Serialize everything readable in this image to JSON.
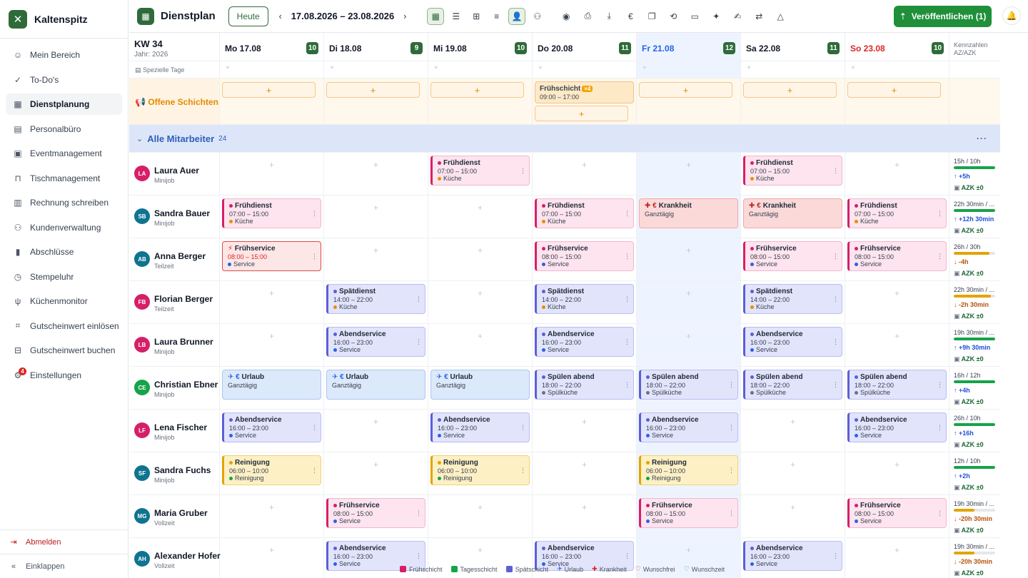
{
  "app": {
    "name": "Kaltenspitz"
  },
  "sidebar": {
    "items": [
      {
        "label": "Mein Bereich",
        "icon": "user-icon"
      },
      {
        "label": "To-Do's",
        "icon": "check-circle-icon"
      },
      {
        "label": "Dienstplanung",
        "icon": "calendar-icon",
        "active": true
      },
      {
        "label": "Personalbüro",
        "icon": "clipboard-icon"
      },
      {
        "label": "Eventmanagement",
        "icon": "calendar-event-icon"
      },
      {
        "label": "Tischmanagement",
        "icon": "table-icon"
      },
      {
        "label": "Rechnung schreiben",
        "icon": "invoice-icon"
      },
      {
        "label": "Kundenverwaltung",
        "icon": "users-icon"
      },
      {
        "label": "Abschlüsse",
        "icon": "chart-icon"
      },
      {
        "label": "Stempeluhr",
        "icon": "clock-icon"
      },
      {
        "label": "Küchenmonitor",
        "icon": "utensils-icon"
      },
      {
        "label": "Gutscheinwert einlösen",
        "icon": "scan-icon"
      },
      {
        "label": "Gutscheinwert buchen",
        "icon": "gift-icon"
      },
      {
        "label": "Einstellungen",
        "icon": "gear-icon",
        "badge": "4"
      }
    ],
    "logout": "Abmelden",
    "collapse": "Einklappen"
  },
  "toolbar": {
    "title": "Dienstplan",
    "today": "Heute",
    "daterange": "17.08.2026 – 23.08.2026",
    "publish": "Veröffentlichen (1)"
  },
  "header": {
    "week": "KW 34",
    "year": "Jahr: 2026",
    "special_days": "Spezielle Tage",
    "kennzahlen": "Kennzahlen",
    "kennzahlen_sub": "AZ/AZK",
    "days": [
      {
        "label": "Mo 17.08",
        "count": "10"
      },
      {
        "label": "Di 18.08",
        "count": "9"
      },
      {
        "label": "Mi 19.08",
        "count": "10"
      },
      {
        "label": "Do 20.08",
        "count": "11"
      },
      {
        "label": "Fr 21.08",
        "count": "12"
      },
      {
        "label": "Sa 22.08",
        "count": "11"
      },
      {
        "label": "So 23.08",
        "count": "10"
      }
    ]
  },
  "open_shifts": {
    "title": "Offene Schichten",
    "thursday": {
      "title": "Frühschicht",
      "badge": "×4",
      "time": "09:00 – 17:00"
    }
  },
  "group": {
    "title": "Alle Mitarbeiter",
    "count": "24"
  },
  "employees": [
    {
      "initials": "LA",
      "name": "Laura Auer",
      "type": "Minijob",
      "color": "#d61f69",
      "kz": {
        "a": "15h / 10h",
        "b": "↑ +5h",
        "c": "AZK ±0",
        "fill": 100,
        "fc": "#16a34a",
        "bc": "#1d4ed8"
      },
      "shifts": [
        null,
        null,
        {
          "k": "frueh",
          "t": "Frühdienst",
          "time": "07:00 – 15:00",
          "d": "Küche",
          "dc": "#ea8c00"
        },
        null,
        null,
        {
          "k": "frueh",
          "t": "Frühdienst",
          "time": "07:00 – 15:00",
          "d": "Küche",
          "dc": "#ea8c00"
        },
        null
      ]
    },
    {
      "initials": "SB",
      "name": "Sandra Bauer",
      "type": "Minijob",
      "color": "#0e7490",
      "kz": {
        "a": "22h 30min / ...",
        "b": "↑ +12h 30min",
        "c": "AZK ±0",
        "fill": 100,
        "fc": "#16a34a",
        "bc": "#1d4ed8"
      },
      "shifts": [
        {
          "k": "frueh",
          "t": "Frühdienst",
          "time": "07:00 – 15:00",
          "d": "Küche",
          "dc": "#ea8c00"
        },
        null,
        null,
        {
          "k": "frueh",
          "t": "Frühdienst",
          "time": "07:00 – 15:00",
          "d": "Küche",
          "dc": "#ea8c00"
        },
        {
          "k": "krank",
          "t": "Krankheit",
          "time": "Ganztägig"
        },
        {
          "k": "krank",
          "t": "Krankheit",
          "time": "Ganztägig"
        },
        {
          "k": "frueh",
          "t": "Frühdienst",
          "time": "07:00 – 15:00",
          "d": "Küche",
          "dc": "#ea8c00"
        }
      ]
    },
    {
      "initials": "AB",
      "name": "Anna Berger",
      "type": "Teilzeit",
      "color": "#0e7490",
      "kz": {
        "a": "26h / 30h",
        "b": "↓ -4h",
        "c": "AZK ±0",
        "fill": 86,
        "fc": "#e2a400",
        "bc": "#b45309"
      },
      "shifts": [
        {
          "k": "fruehred",
          "t": "Frühservice",
          "time": "08:00 – 15:00",
          "d": "Service",
          "dc": "#2563eb"
        },
        null,
        null,
        {
          "k": "frueh",
          "t": "Frühservice",
          "time": "08:00 – 15:00",
          "d": "Service",
          "dc": "#2563eb"
        },
        null,
        {
          "k": "frueh",
          "t": "Frühservice",
          "time": "08:00 – 15:00",
          "d": "Service",
          "dc": "#2563eb"
        },
        {
          "k": "frueh",
          "t": "Frühservice",
          "time": "08:00 – 15:00",
          "d": "Service",
          "dc": "#2563eb"
        }
      ]
    },
    {
      "initials": "FB",
      "name": "Florian Berger",
      "type": "Teilzeit",
      "color": "#d61f69",
      "kz": {
        "a": "22h 30min / ...",
        "b": "↓ -2h 30min",
        "c": "AZK ±0",
        "fill": 90,
        "fc": "#e2a400",
        "bc": "#b45309"
      },
      "shifts": [
        null,
        {
          "k": "sp",
          "t": "Spätdienst",
          "time": "14:00 – 22:00",
          "d": "Küche",
          "dc": "#ea8c00"
        },
        null,
        {
          "k": "sp",
          "t": "Spätdienst",
          "time": "14:00 – 22:00",
          "d": "Küche",
          "dc": "#ea8c00"
        },
        null,
        {
          "k": "sp",
          "t": "Spätdienst",
          "time": "14:00 – 22:00",
          "d": "Küche",
          "dc": "#ea8c00"
        },
        null
      ]
    },
    {
      "initials": "LB",
      "name": "Laura Brunner",
      "type": "Minijob",
      "color": "#d61f69",
      "kz": {
        "a": "19h 30min / ...",
        "b": "↑ +9h 30min",
        "c": "AZK ±0",
        "fill": 100,
        "fc": "#16a34a",
        "bc": "#1d4ed8"
      },
      "shifts": [
        null,
        {
          "k": "sp",
          "t": "Abendservice",
          "time": "16:00 – 23:00",
          "d": "Service",
          "dc": "#2563eb"
        },
        null,
        {
          "k": "sp",
          "t": "Abendservice",
          "time": "16:00 – 23:00",
          "d": "Service",
          "dc": "#2563eb"
        },
        null,
        {
          "k": "sp",
          "t": "Abendservice",
          "time": "16:00 – 23:00",
          "d": "Service",
          "dc": "#2563eb"
        },
        null
      ]
    },
    {
      "initials": "CE",
      "name": "Christian Ebner",
      "type": "Minijob",
      "color": "#16a34a",
      "kz": {
        "a": "16h / 12h",
        "b": "↑ +4h",
        "c": "AZK ±0",
        "fill": 100,
        "fc": "#16a34a",
        "bc": "#1d4ed8"
      },
      "shifts": [
        {
          "k": "urlaub",
          "t": "Urlaub",
          "time": "Ganztägig"
        },
        {
          "k": "urlaub",
          "t": "Urlaub",
          "time": "Ganztägig"
        },
        {
          "k": "urlaub",
          "t": "Urlaub",
          "time": "Ganztägig"
        },
        {
          "k": "sp",
          "t": "Spülen abend",
          "time": "18:00 – 22:00",
          "d": "Spülküche",
          "dc": "#6b7280"
        },
        {
          "k": "sp",
          "t": "Spülen abend",
          "time": "18:00 – 22:00",
          "d": "Spülküche",
          "dc": "#6b7280"
        },
        {
          "k": "sp",
          "t": "Spülen abend",
          "time": "18:00 – 22:00",
          "d": "Spülküche",
          "dc": "#6b7280"
        },
        {
          "k": "sp",
          "t": "Spülen abend",
          "time": "18:00 – 22:00",
          "d": "Spülküche",
          "dc": "#6b7280"
        }
      ]
    },
    {
      "initials": "LF",
      "name": "Lena Fischer",
      "type": "Minijob",
      "color": "#d61f69",
      "kz": {
        "a": "26h / 10h",
        "b": "↑ +16h",
        "c": "AZK ±0",
        "fill": 100,
        "fc": "#16a34a",
        "bc": "#1d4ed8"
      },
      "shifts": [
        {
          "k": "sp",
          "t": "Abendservice",
          "time": "16:00 – 23:00",
          "d": "Service",
          "dc": "#2563eb"
        },
        null,
        {
          "k": "sp",
          "t": "Abendservice",
          "time": "16:00 – 23:00",
          "d": "Service",
          "dc": "#2563eb"
        },
        null,
        {
          "k": "sp",
          "t": "Abendservice",
          "time": "16:00 – 23:00",
          "d": "Service",
          "dc": "#2563eb"
        },
        null,
        {
          "k": "sp",
          "t": "Abendservice",
          "time": "16:00 – 23:00",
          "d": "Service",
          "dc": "#2563eb"
        }
      ]
    },
    {
      "initials": "SF",
      "name": "Sandra Fuchs",
      "type": "Minijob",
      "color": "#0e7490",
      "kz": {
        "a": "12h / 10h",
        "b": "↑ +2h",
        "c": "AZK ±0",
        "fill": 100,
        "fc": "#16a34a",
        "bc": "#1d4ed8"
      },
      "shifts": [
        {
          "k": "rein",
          "t": "Reinigung",
          "time": "06:00 – 10:00",
          "d": "Reinigung",
          "dc": "#16a34a"
        },
        null,
        {
          "k": "rein",
          "t": "Reinigung",
          "time": "06:00 – 10:00",
          "d": "Reinigung",
          "dc": "#16a34a"
        },
        null,
        {
          "k": "rein",
          "t": "Reinigung",
          "time": "06:00 – 10:00",
          "d": "Reinigung",
          "dc": "#16a34a"
        },
        null,
        null
      ]
    },
    {
      "initials": "MG",
      "name": "Maria Gruber",
      "type": "Vollzeit",
      "color": "#0e7490",
      "kz": {
        "a": "19h 30min / ...",
        "b": "↓ -20h 30min",
        "c": "AZK ±0",
        "fill": 50,
        "fc": "#e2a400",
        "bc": "#b45309"
      },
      "shifts": [
        null,
        {
          "k": "frueh",
          "t": "Frühservice",
          "time": "08:00 – 15:00",
          "d": "Service",
          "dc": "#2563eb"
        },
        null,
        null,
        {
          "k": "frueh",
          "t": "Frühservice",
          "time": "08:00 – 15:00",
          "d": "Service",
          "dc": "#2563eb"
        },
        null,
        {
          "k": "frueh",
          "t": "Frühservice",
          "time": "08:00 – 15:00",
          "d": "Service",
          "dc": "#2563eb"
        }
      ]
    },
    {
      "initials": "AH",
      "name": "Alexander Hofer",
      "type": "Vollzeit",
      "color": "#0e7490",
      "kz": {
        "a": "19h 30min / ...",
        "b": "↓ -20h 30min",
        "c": "AZK ±0",
        "fill": 50,
        "fc": "#e2a400",
        "bc": "#b45309"
      },
      "shifts": [
        null,
        {
          "k": "sp",
          "t": "Abendservice",
          "time": "16:00 – 23:00",
          "d": "Service",
          "dc": "#2563eb"
        },
        null,
        {
          "k": "sp",
          "t": "Abendservice",
          "time": "16:00 – 23:00",
          "d": "Service",
          "dc": "#2563eb"
        },
        null,
        {
          "k": "sp",
          "t": "Abendservice",
          "time": "16:00 – 23:00",
          "d": "Service",
          "dc": "#2563eb"
        },
        null
      ]
    }
  ],
  "legend": [
    {
      "label": "Frühschicht",
      "kind": "swatch",
      "color": "#d61f69"
    },
    {
      "label": "Tagesschicht",
      "kind": "swatch",
      "color": "#16a34a"
    },
    {
      "label": "Spätschicht",
      "kind": "swatch",
      "color": "#5b5fd6"
    },
    {
      "label": "Urlaub",
      "kind": "icon",
      "icon": "plane-icon",
      "glyph": "✈",
      "color": "#2563eb"
    },
    {
      "label": "Krankheit",
      "kind": "icon",
      "icon": "bandage-icon",
      "glyph": "✚",
      "color": "#dc2626"
    },
    {
      "label": "Wunschfrei",
      "kind": "icon",
      "icon": "heart-icon",
      "glyph": "♡",
      "color": "#dc2626"
    },
    {
      "label": "Wunschzeit",
      "kind": "icon",
      "icon": "heart-icon",
      "glyph": "♡",
      "color": "#16a34a"
    }
  ]
}
